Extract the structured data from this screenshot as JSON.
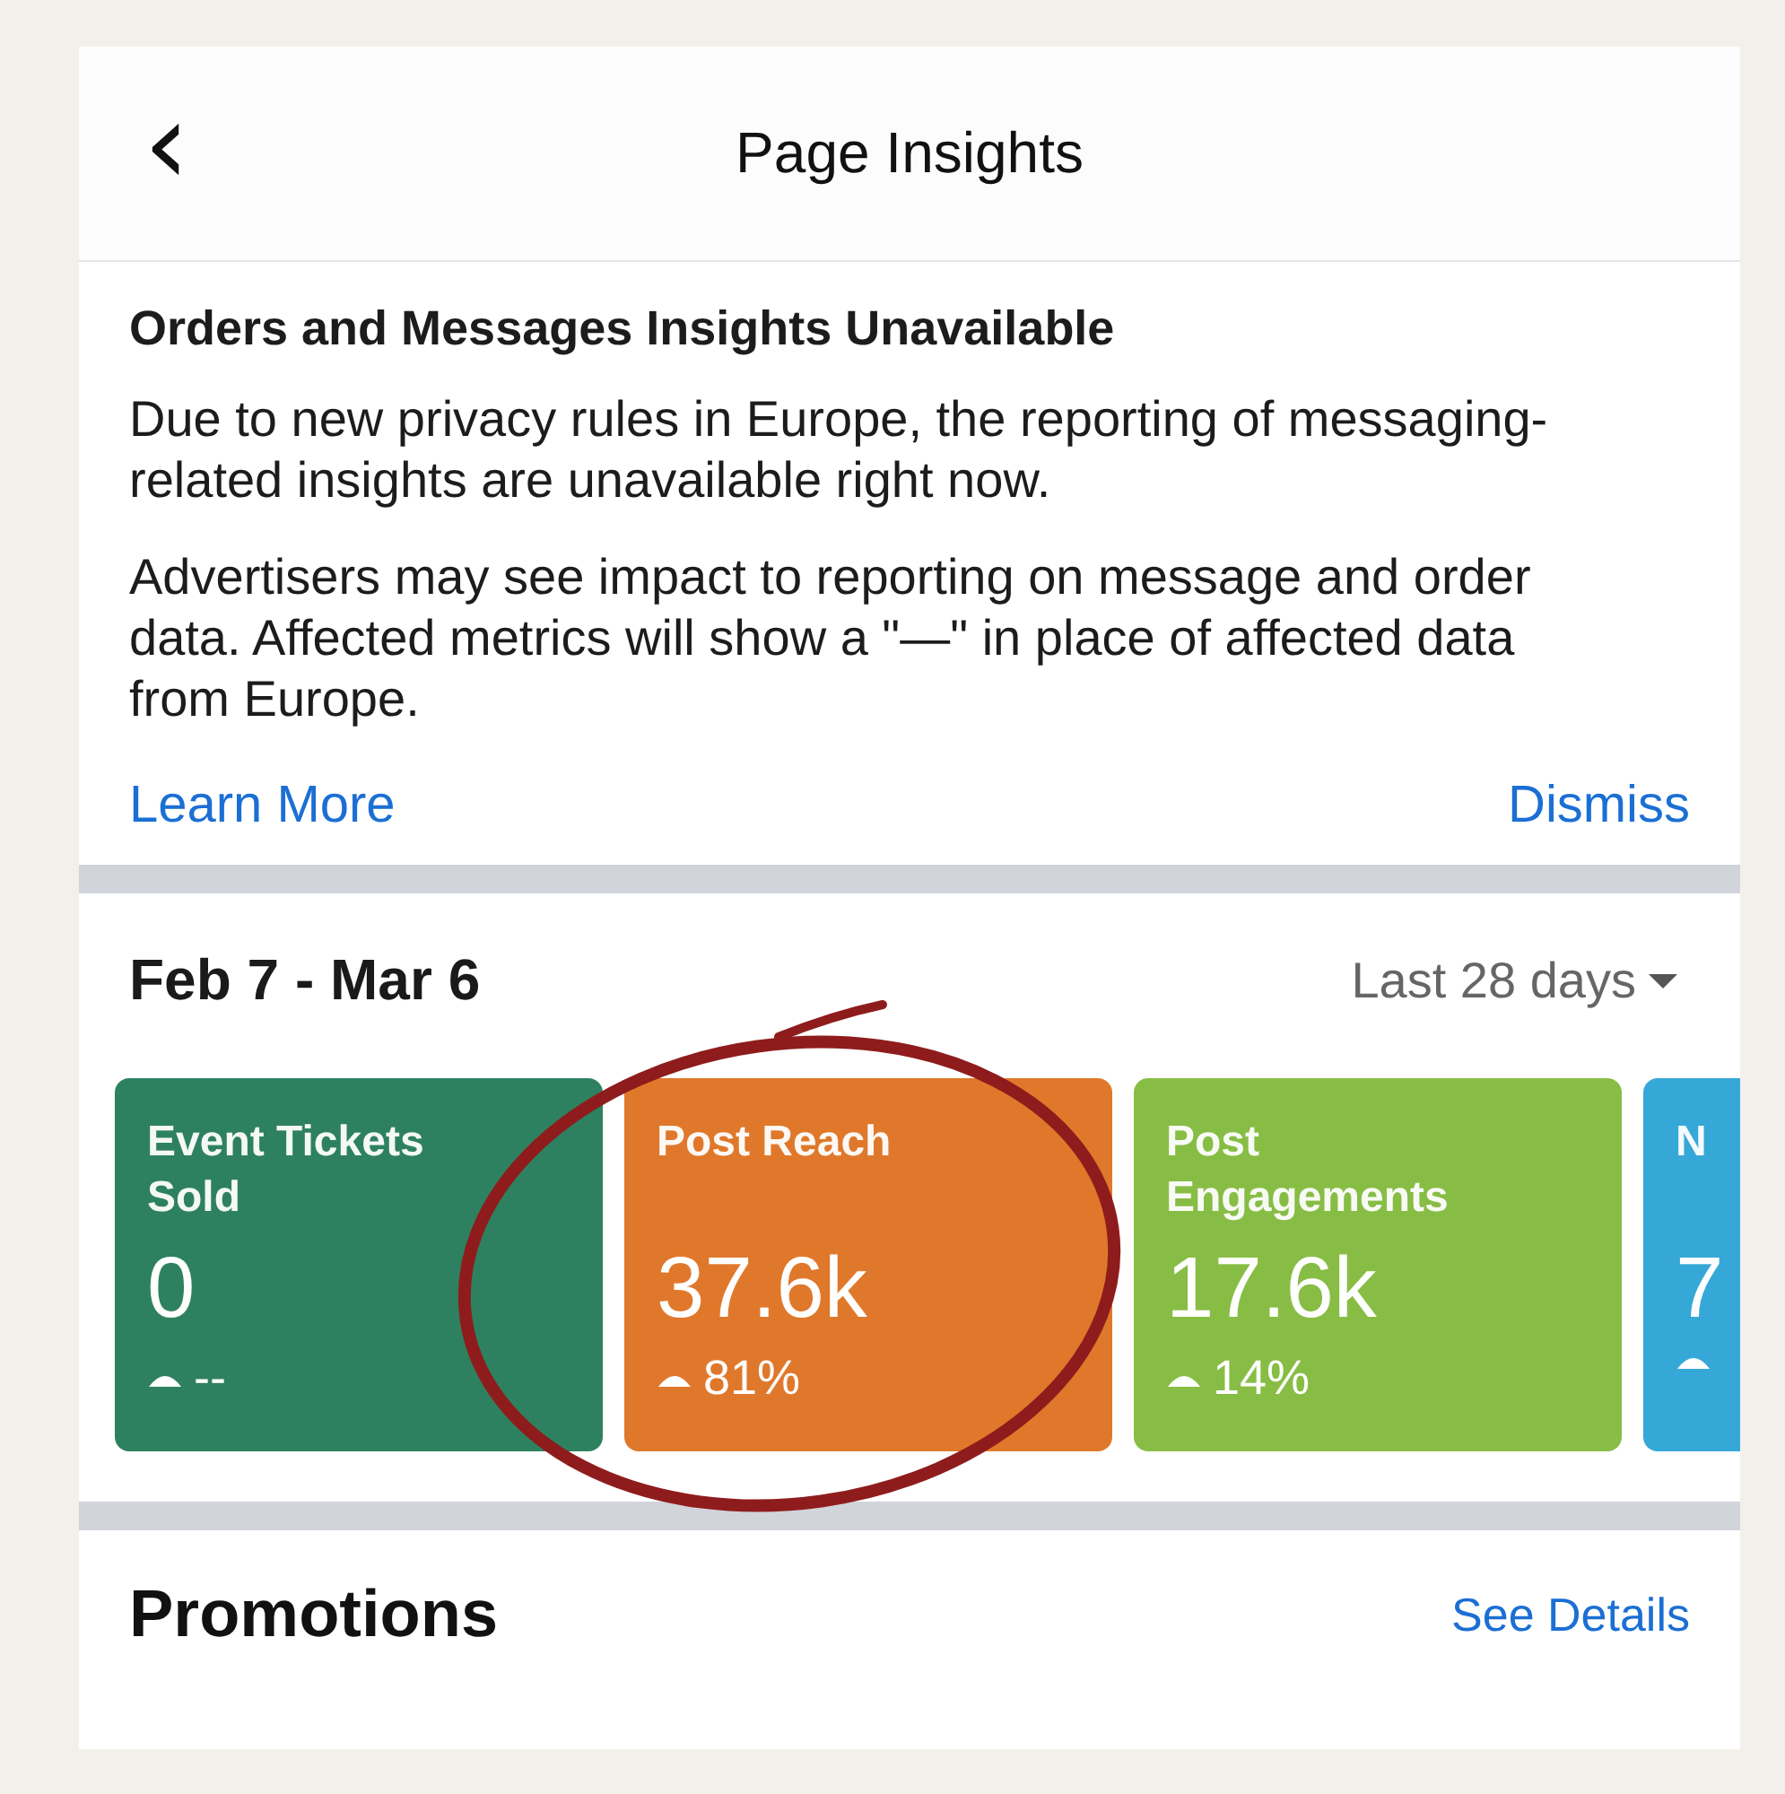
{
  "header": {
    "back": "‹",
    "title": "Page Insights"
  },
  "notice": {
    "title": "Orders and Messages Insights Unavailable",
    "paragraphs": [
      "Due to new privacy rules in Europe, the reporting of messaging-related insights are unavailable right now.",
      "Advertisers may see impact to reporting on message and order data. Affected metrics will show a \"—\" in place of affected data from Europe."
    ],
    "learn_more": "Learn More",
    "dismiss": "Dismiss"
  },
  "period": {
    "range": "Feb 7 - Mar 6",
    "selector": "Last 28 days"
  },
  "cards": [
    {
      "label": "Event Tickets Sold",
      "value": "0",
      "trend": "--",
      "color": "#2e8160"
    },
    {
      "label": "Post Reach",
      "value": "37.6k",
      "trend": "81%",
      "color": "#e0782b"
    },
    {
      "label": "Post Engagements",
      "value": "17.6k",
      "trend": "14%",
      "color": "#88bd45"
    },
    {
      "label": "N",
      "value": "7",
      "color": "#35a8d8"
    }
  ],
  "promotions": {
    "title": "Promotions",
    "link": "See Details"
  }
}
